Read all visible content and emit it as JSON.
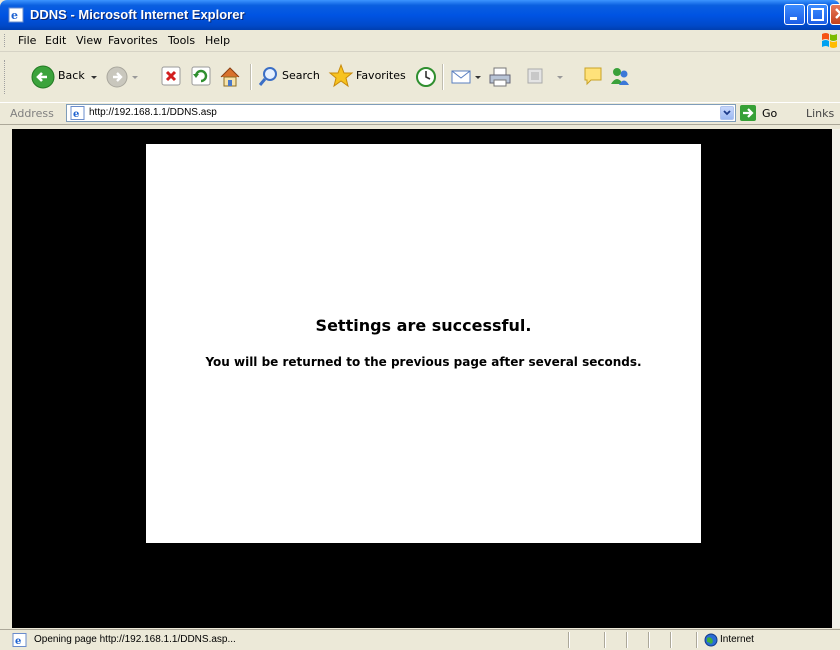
{
  "window": {
    "title": "DDNS - Microsoft Internet Explorer"
  },
  "menu": [
    "File",
    "Edit",
    "View",
    "Favorites",
    "Tools",
    "Help"
  ],
  "toolbar": {
    "back_label": "Back",
    "search_label": "Search",
    "favorites_label": "Favorites"
  },
  "address": {
    "label": "Address",
    "url": "http://192.168.1.1/DDNS.asp",
    "go_label": "Go",
    "links_label": "Links"
  },
  "page": {
    "message_title": "Settings are successful.",
    "message_sub": "You will be returned to the previous page after several seconds."
  },
  "status": {
    "text": "Opening page http://192.168.1.1/DDNS.asp...",
    "zone": "Internet"
  },
  "colors": {
    "titlebar": "#0054e3",
    "chrome": "#ece9d8",
    "content_bg": "#000000",
    "dialog_bg": "#ffffff"
  },
  "icons": [
    "ie-page-icon",
    "minimize-icon",
    "maximize-icon",
    "close-icon",
    "xp-flag-icon",
    "back-arrow-icon",
    "forward-arrow-icon",
    "stop-icon",
    "refresh-icon",
    "home-icon",
    "search-icon",
    "favorites-star-icon",
    "history-icon",
    "mail-icon",
    "print-icon",
    "edit-icon",
    "discuss-icon",
    "messenger-icon",
    "go-arrow-icon",
    "globe-icon"
  ]
}
